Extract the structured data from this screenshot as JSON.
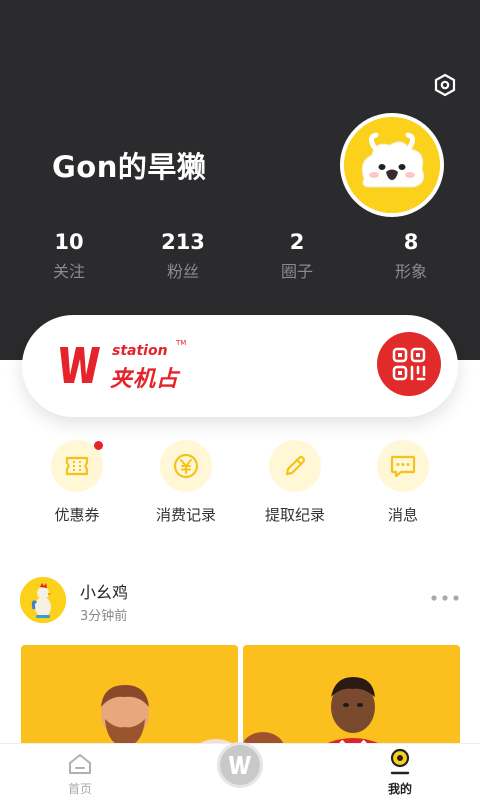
{
  "profile": {
    "name": "Gon的旱獭",
    "stats": [
      {
        "value": "10",
        "label": "关注"
      },
      {
        "value": "213",
        "label": "粉丝"
      },
      {
        "value": "2",
        "label": "圈子"
      },
      {
        "value": "8",
        "label": "形象"
      }
    ]
  },
  "promo": {
    "brand_en": "station",
    "brand_tm": "TM",
    "brand_cn": "夹机占"
  },
  "actions": [
    {
      "label": "优惠券",
      "icon": "coupon-icon",
      "has_badge": true
    },
    {
      "label": "消费记录",
      "icon": "yen-icon",
      "has_badge": false
    },
    {
      "label": "提取纪录",
      "icon": "pencil-icon",
      "has_badge": false
    },
    {
      "label": "消息",
      "icon": "message-icon",
      "has_badge": false
    }
  ],
  "post": {
    "author": "小幺鸡",
    "time": "3分钟前"
  },
  "tabs": [
    {
      "label": "首页",
      "icon": "home-icon",
      "active": false
    },
    {
      "label": "我的",
      "icon": "profile-icon",
      "active": true
    }
  ],
  "colors": {
    "header_bg": "#2b2a2c",
    "accent_yellow": "#fbd11c",
    "brand_red": "#e5232a"
  }
}
